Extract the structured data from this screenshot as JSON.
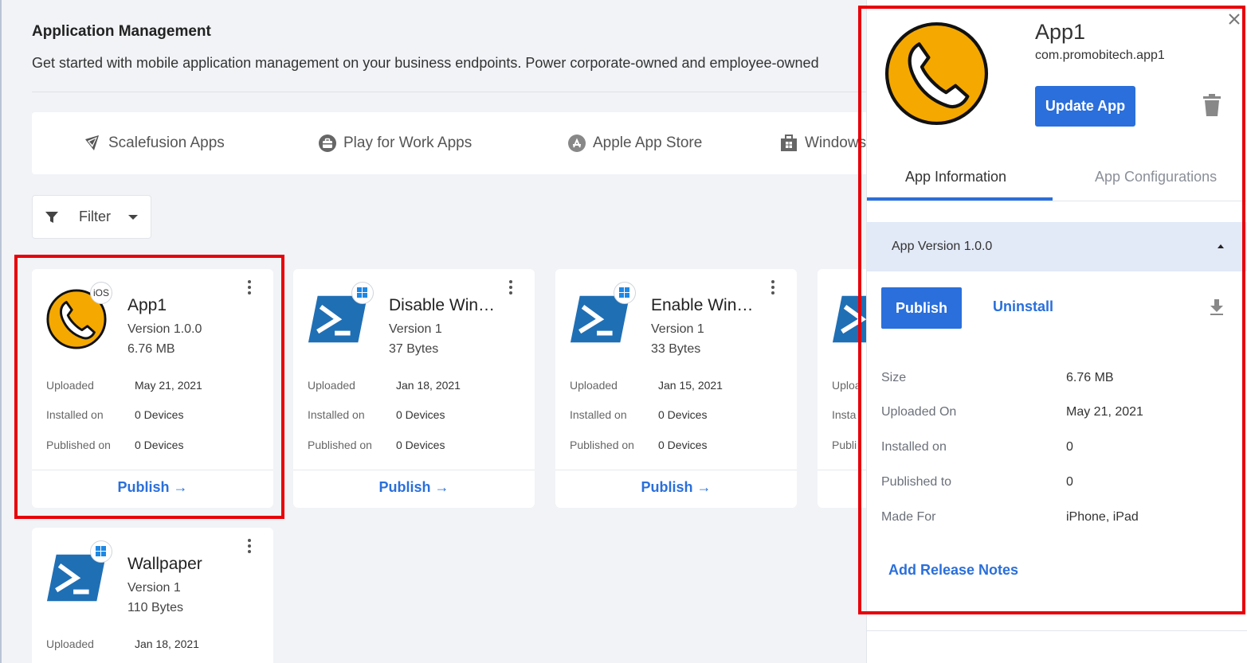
{
  "page": {
    "title": "Application Management",
    "description": "Get started with mobile application management on your business endpoints. Power corporate-owned and employee-owned"
  },
  "store_tabs": [
    {
      "label": "Scalefusion Apps",
      "icon": "scalefusion-icon"
    },
    {
      "label": "Play for Work Apps",
      "icon": "briefcase-icon"
    },
    {
      "label": "Apple App Store",
      "icon": "app-store-icon"
    },
    {
      "label": "Windows",
      "icon": "windows-store-icon"
    }
  ],
  "filter": {
    "label": "Filter"
  },
  "apps": [
    {
      "name": "App1",
      "version": "Version 1.0.0",
      "size": "6.76 MB",
      "platform": "iOS",
      "icon": "phone-app-icon",
      "uploaded_label": "Uploaded",
      "uploaded": "May 21, 2021",
      "installed_label": "Installed on",
      "installed": "0 Devices",
      "published_label": "Published on",
      "published": "0 Devices",
      "action": "Publish"
    },
    {
      "name": "Disable Win…",
      "version": "Version 1",
      "size": "37 Bytes",
      "platform": "windows",
      "icon": "powershell-icon",
      "uploaded_label": "Uploaded",
      "uploaded": "Jan 18, 2021",
      "installed_label": "Installed on",
      "installed": "0 Devices",
      "published_label": "Published on",
      "published": "0 Devices",
      "action": "Publish"
    },
    {
      "name": "Enable Wind…",
      "version": "Version 1",
      "size": "33 Bytes",
      "platform": "windows",
      "icon": "powershell-icon",
      "uploaded_label": "Uploaded",
      "uploaded": "Jan 15, 2021",
      "installed_label": "Installed on",
      "installed": "0 Devices",
      "published_label": "Published on",
      "published": "0 Devices",
      "action": "Publish"
    },
    {
      "name": "",
      "version": "",
      "size": "",
      "platform": "windows",
      "icon": "powershell-icon",
      "uploaded_label": "Uploa",
      "uploaded": "",
      "installed_label": "Insta",
      "installed": "",
      "published_label": "Publi",
      "published": "",
      "action": ""
    },
    {
      "name": "Wallpaper",
      "version": "Version 1",
      "size": "110 Bytes",
      "platform": "windows",
      "icon": "powershell-icon",
      "uploaded_label": "Uploaded",
      "uploaded": "Jan 18, 2021"
    }
  ],
  "panel": {
    "name": "App1",
    "package": "com.promobitech.app1",
    "update_label": "Update App",
    "tabs": [
      "App Information",
      "App Configurations"
    ],
    "version_header": "App Version 1.0.0",
    "publish_label": "Publish",
    "uninstall_label": "Uninstall",
    "info": [
      {
        "label": "Size",
        "value": "6.76 MB"
      },
      {
        "label": "Uploaded On",
        "value": "May 21, 2021"
      },
      {
        "label": "Installed on",
        "value": "0"
      },
      {
        "label": "Published to",
        "value": "0"
      },
      {
        "label": "Made For",
        "value": "iPhone, iPad"
      }
    ],
    "release_notes_label": "Add Release Notes"
  },
  "colors": {
    "accent": "#2a6fdb",
    "highlight": "#e8000b",
    "app_icon": "#f5a800",
    "powershell": "#1f6fb5"
  }
}
